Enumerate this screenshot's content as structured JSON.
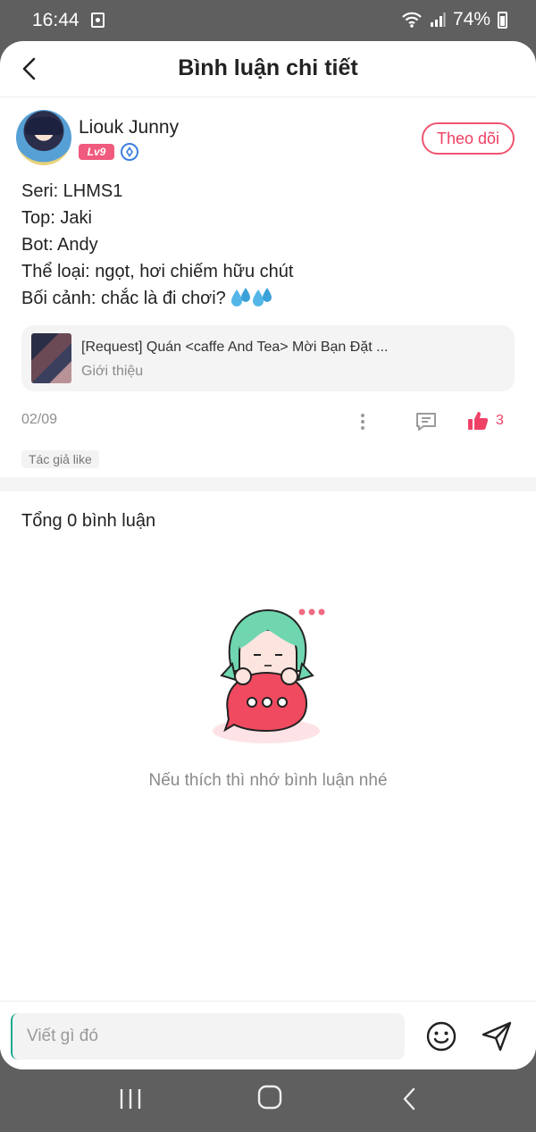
{
  "status_bar": {
    "time": "16:44",
    "battery": "74%"
  },
  "header": {
    "title": "Bình luận chi tiết"
  },
  "post": {
    "author": {
      "name": "Liouk Junny",
      "level": "Lv9"
    },
    "follow_label": "Theo dõi",
    "lines": [
      "Seri: LHMS1",
      "Top: Jaki",
      "Bot: Andy",
      "Thể loại: ngọt, hơi chiếm hữu chút",
      "Bối cảnh: chắc là đi chơi?"
    ],
    "linked_card": {
      "title": "[Request] Quán <caffe And Tea> Mời Bạn Đặt ...",
      "subtitle": "Giới thiệu"
    },
    "date": "02/09",
    "like_count": "3",
    "author_liked_tag": "Tác giả like"
  },
  "comments": {
    "total_label": "Tổng 0 bình luận",
    "empty_message": "Nếu thích thì nhớ bình luận nhé"
  },
  "composer": {
    "placeholder": "Viết gì đó"
  },
  "colors": {
    "accent": "#ef4166",
    "background_dim": "#5f5f5f"
  }
}
